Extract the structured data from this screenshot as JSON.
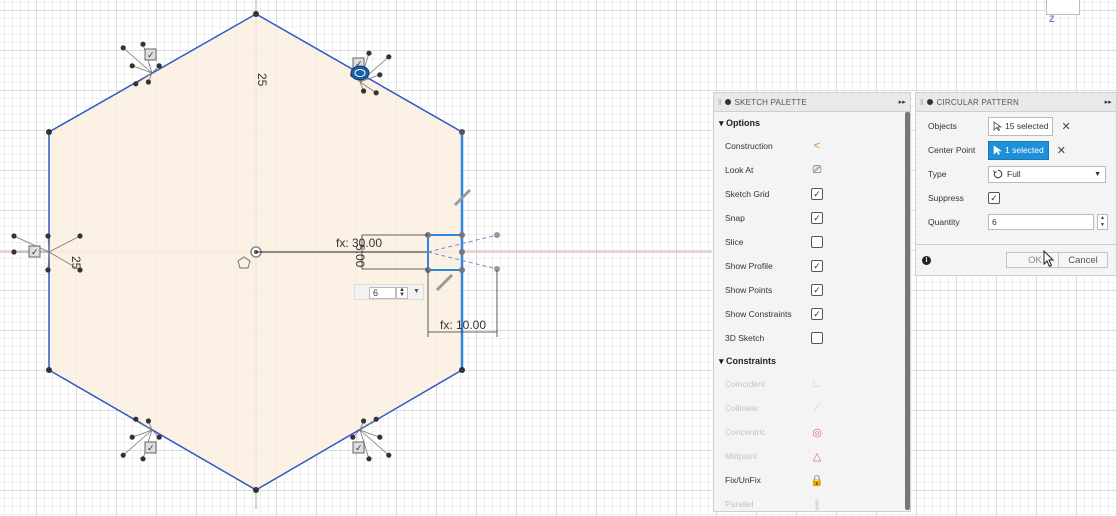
{
  "sketch": {
    "dim_vertical_25": "25",
    "dim_left_25": "25",
    "dim_angle": "fx: 30.00",
    "dim_offset": "5.00",
    "dim_fx_prefix": "fx:",
    "dim_width": "fx: 10.00",
    "mini_quantity": "6",
    "colors": {
      "profile_fill": "#fbeee0",
      "edge": "#2f58c9",
      "selected_edge": "#2f86e0",
      "axis_green": "#88c07a",
      "axis_red": "#e3a6a6"
    }
  },
  "sketch_palette": {
    "title": "SKETCH PALETTE",
    "options_header": "Options",
    "options": [
      {
        "label": "Construction",
        "icon": "construction-icon"
      },
      {
        "label": "Look At",
        "icon": "look-at-icon"
      },
      {
        "label": "Sketch Grid",
        "checked": true
      },
      {
        "label": "Snap",
        "checked": true
      },
      {
        "label": "Slice",
        "checked": false
      },
      {
        "label": "Show Profile",
        "checked": true
      },
      {
        "label": "Show Points",
        "checked": true
      },
      {
        "label": "Show Constraints",
        "checked": true
      },
      {
        "label": "3D Sketch",
        "checked": false
      }
    ],
    "constraints_header": "Constraints",
    "constraints": [
      {
        "label": "Coincident",
        "icon": "coincident-icon"
      },
      {
        "label": "Collinear",
        "icon": "collinear-icon"
      },
      {
        "label": "Concentric",
        "icon": "concentric-icon"
      },
      {
        "label": "Midpoint",
        "icon": "midpoint-icon"
      },
      {
        "label": "Fix/UnFix",
        "icon": "fix-lock-icon"
      },
      {
        "label": "Parallel",
        "icon": "parallel-icon"
      }
    ]
  },
  "circular_pattern": {
    "title": "CIRCULAR PATTERN",
    "objects_label": "Objects",
    "objects_value": "15 selected",
    "center_label": "Center Point",
    "center_value": "1 selected",
    "type_label": "Type",
    "type_value": "Full",
    "suppress_label": "Suppress",
    "suppress_checked": true,
    "quantity_label": "Quantity",
    "quantity_value": "6",
    "ok_label": "OK",
    "cancel_label": "Cancel"
  },
  "viewcube_axis": "Z"
}
